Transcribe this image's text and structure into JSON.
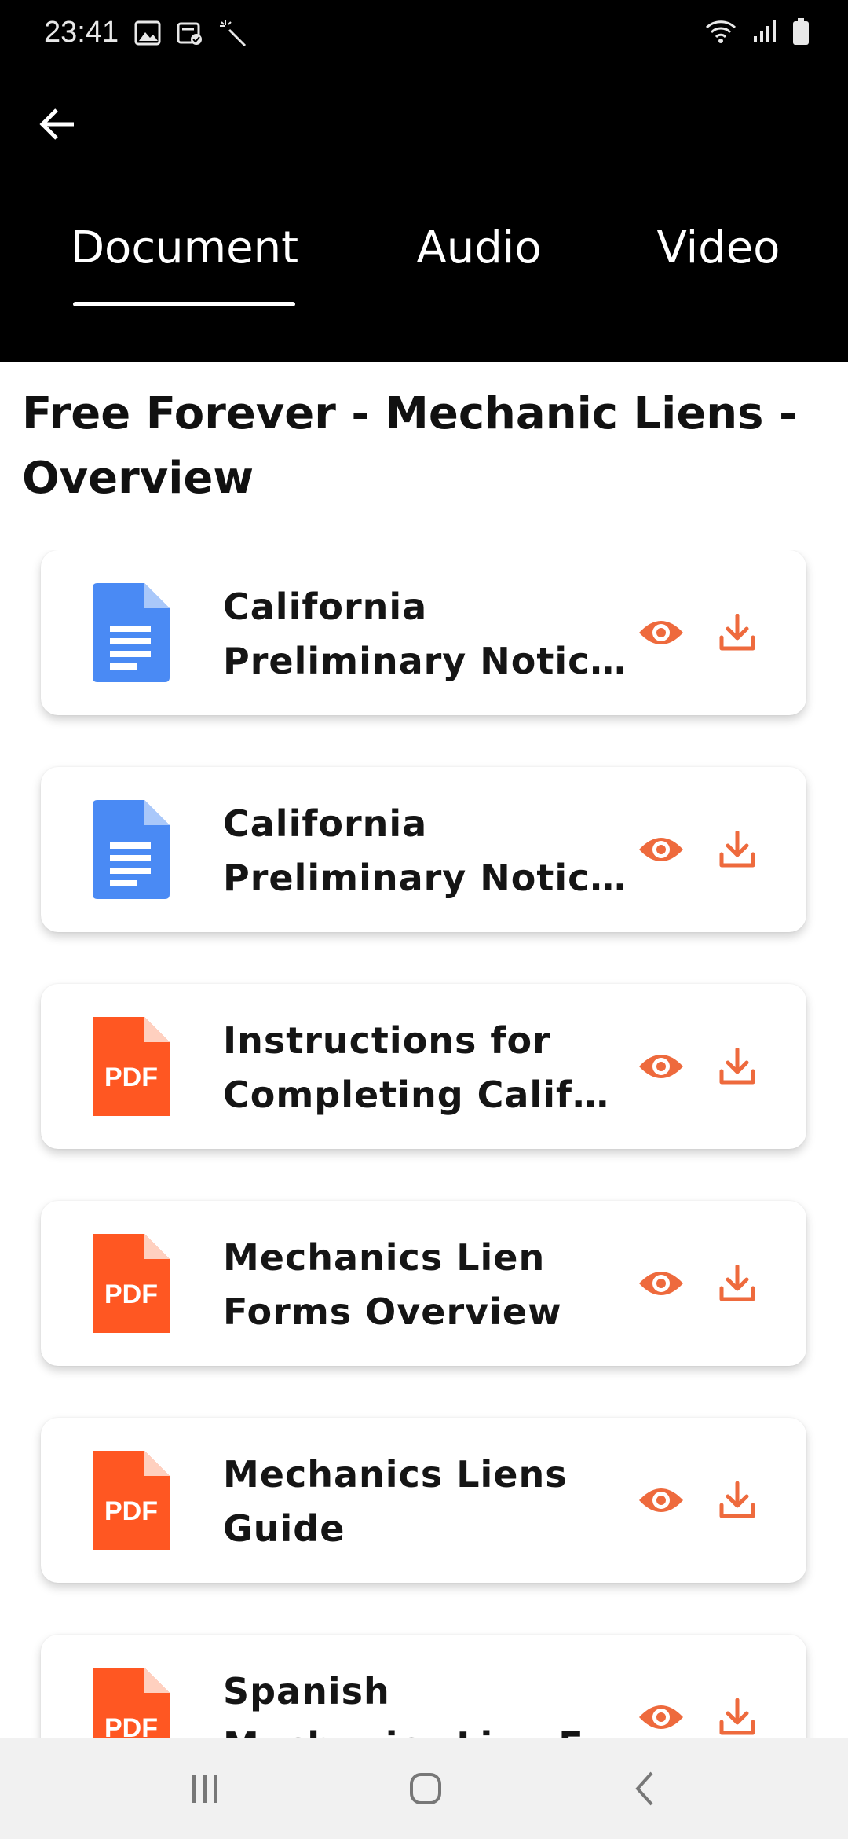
{
  "status_bar": {
    "time": "23:41",
    "left_icons": [
      "image-icon",
      "calendar-check-icon",
      "magic-wand-icon"
    ],
    "right_icons": [
      "wifi-icon",
      "signal-icon",
      "battery-icon"
    ]
  },
  "header": {
    "back_icon": "arrow-left-icon",
    "tabs": [
      {
        "label": "Document",
        "selected": true
      },
      {
        "label": "Audio",
        "selected": false
      },
      {
        "label": "Video",
        "selected": false
      }
    ]
  },
  "page": {
    "title": "Free Forever - Mechanic Liens - Overview"
  },
  "documents": [
    {
      "type": "doc",
      "line1": "California",
      "line2": "Preliminary Notic…"
    },
    {
      "type": "doc",
      "line1": "California",
      "line2": "Preliminary Notic…"
    },
    {
      "type": "pdf",
      "line1": "Instructions for",
      "line2": "Completing Calif…"
    },
    {
      "type": "pdf",
      "line1": "Mechanics Lien",
      "line2": "Forms Overview"
    },
    {
      "type": "pdf",
      "line1": "Mechanics Liens",
      "line2": "Guide"
    },
    {
      "type": "pdf",
      "line1": "Spanish",
      "line2": "Mechanics Lien F…"
    }
  ],
  "file_icon_labels": {
    "pdf": "PDF"
  },
  "colors": {
    "accent": "#EE6A3D",
    "doc_blue": "#4A8AF4",
    "pdf_orange": "#FF5722"
  },
  "nav_bar": {
    "icons": [
      "recent-apps-icon",
      "home-icon",
      "back-icon"
    ]
  }
}
